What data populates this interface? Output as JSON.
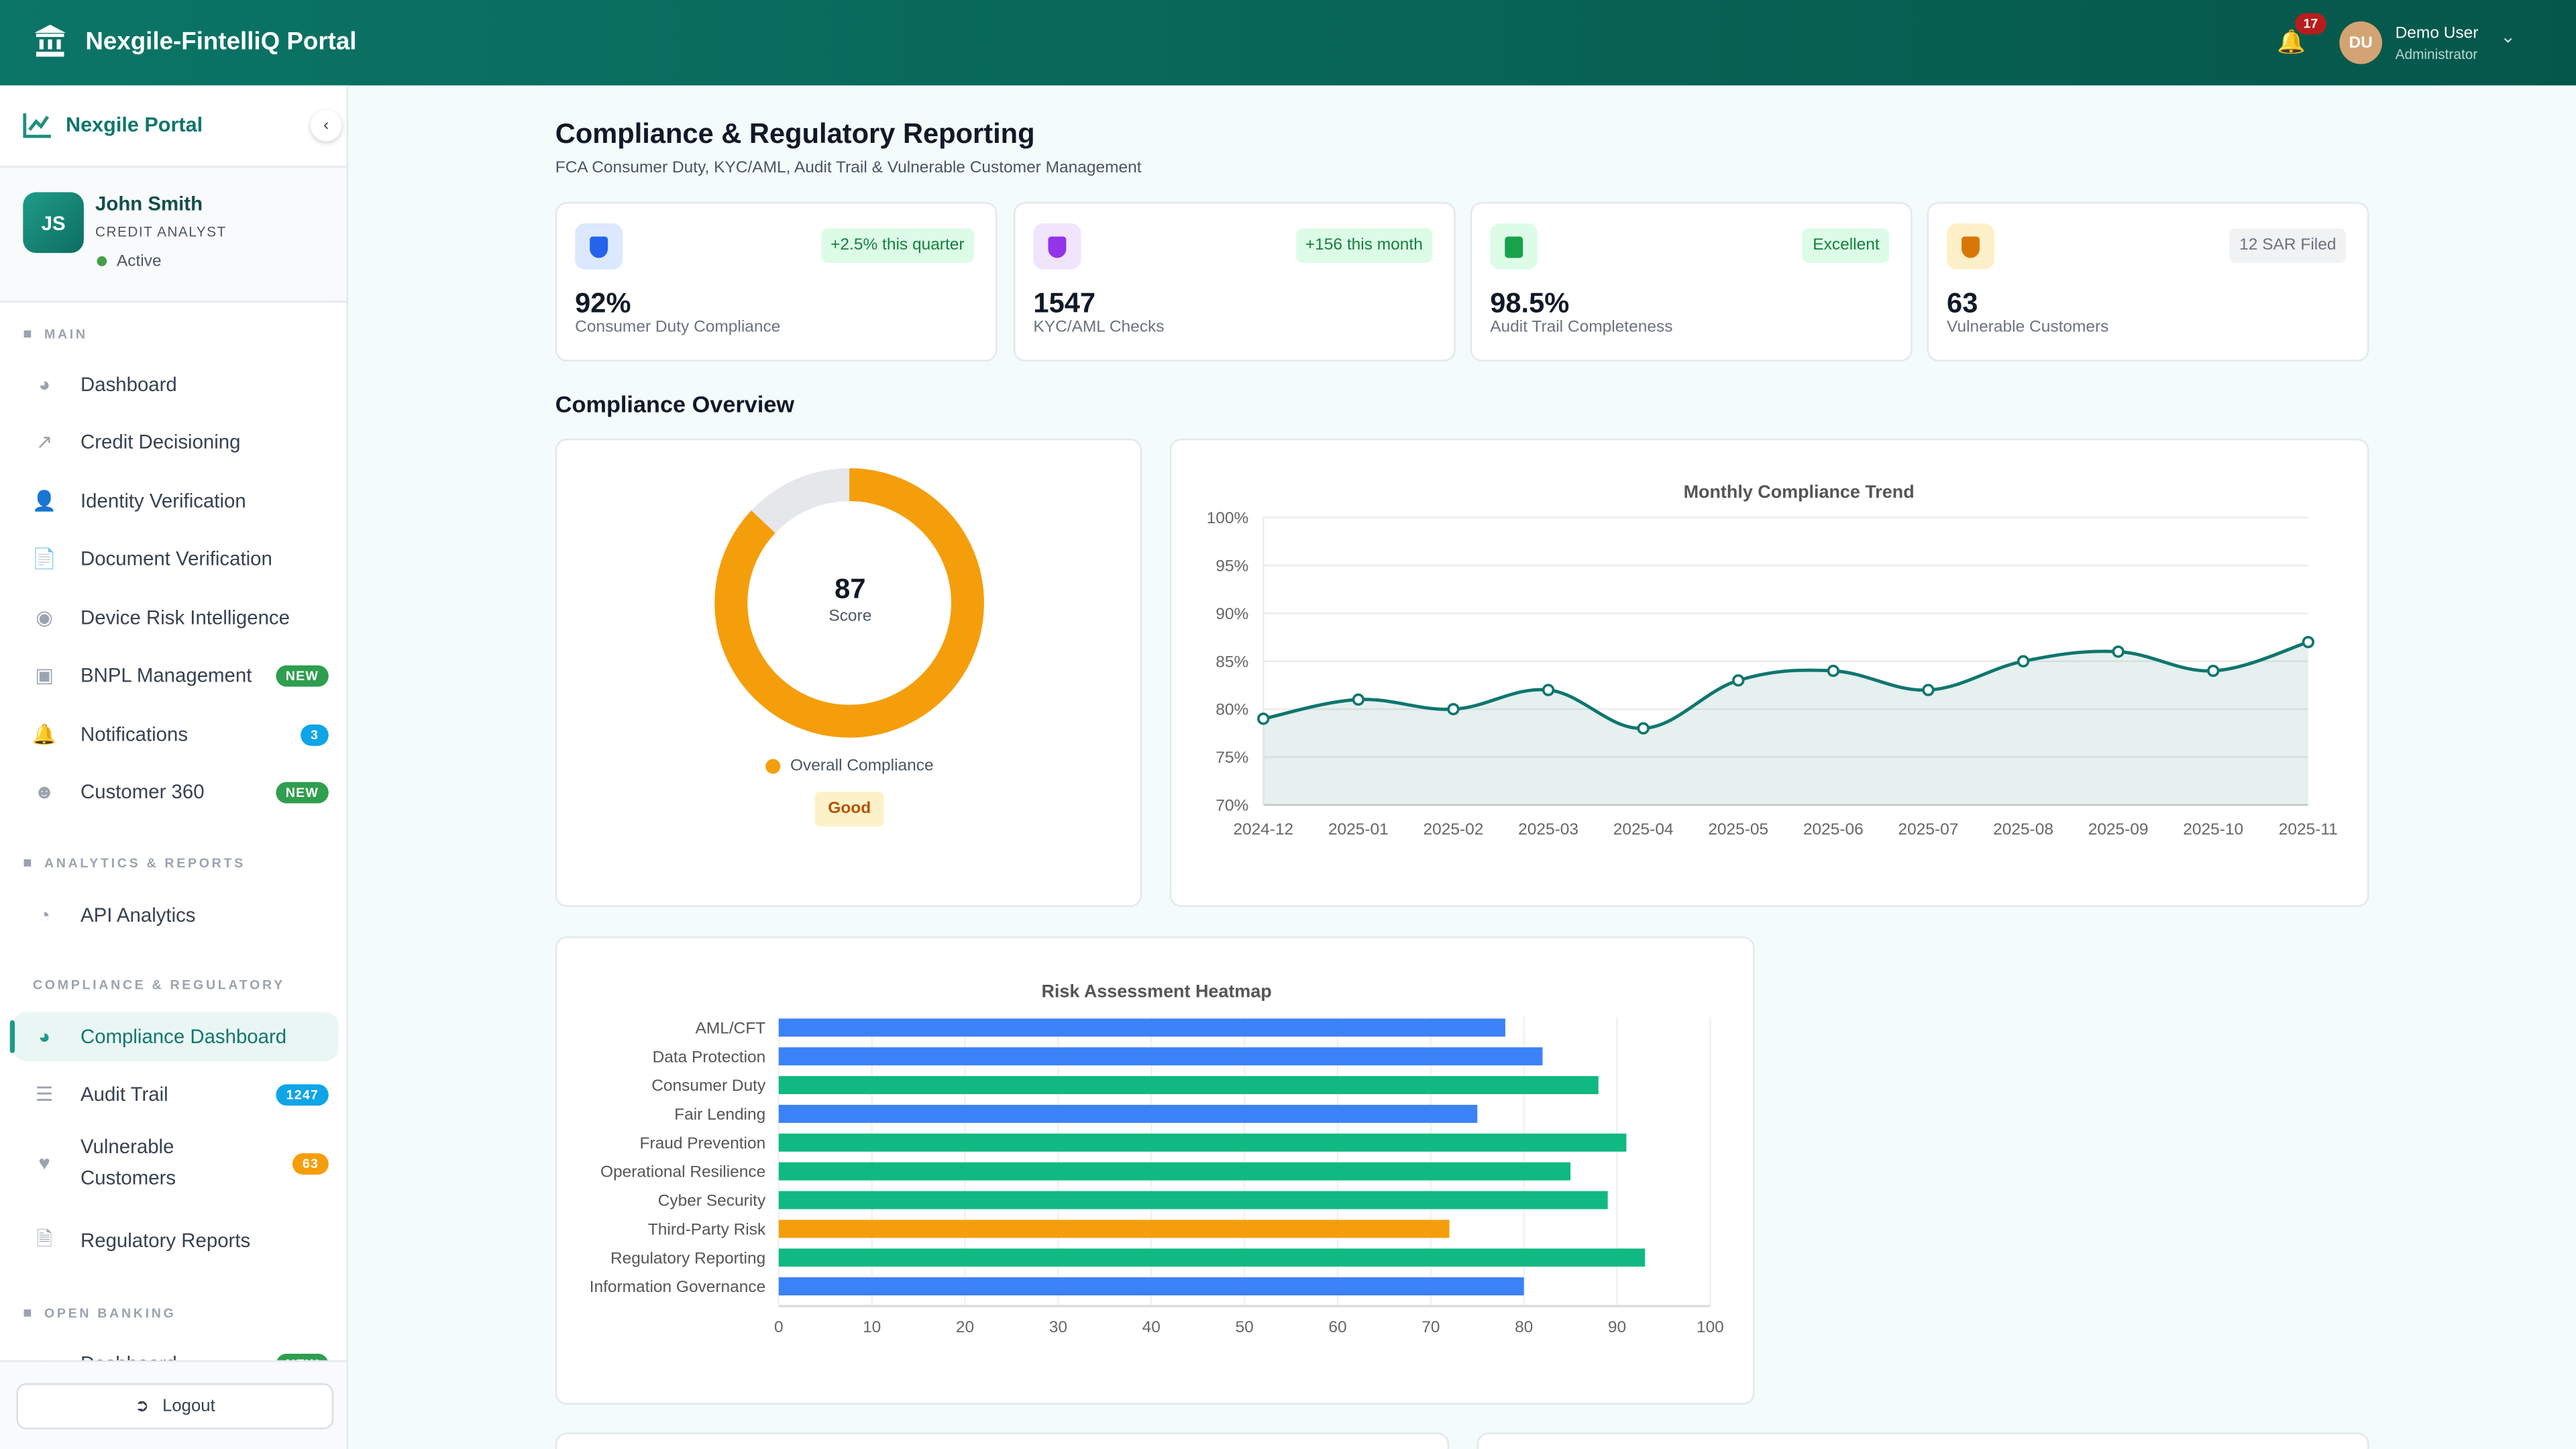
{
  "header": {
    "app_title": "Nexgile-FintelliQ Portal",
    "notification_count": "17",
    "user_initials": "DU",
    "user_name": "Demo User",
    "user_role": "Administrator"
  },
  "sidebar": {
    "brand": "Nexgile Portal",
    "profile": {
      "initials": "JS",
      "name": "John Smith",
      "role": "CREDIT ANALYST",
      "status": "Active"
    },
    "sections": [
      {
        "title": "MAIN",
        "items": [
          {
            "label": "Dashboard",
            "icon": "gauge-icon"
          },
          {
            "label": "Credit Decisioning",
            "icon": "chart-line-icon"
          },
          {
            "label": "Identity Verification",
            "icon": "user-lock-icon"
          },
          {
            "label": "Document Verification",
            "icon": "file-icon"
          },
          {
            "label": "Device Risk Intelligence",
            "icon": "fingerprint-icon"
          },
          {
            "label": "BNPL Management",
            "icon": "wallet-icon",
            "badge": "NEW"
          },
          {
            "label": "Notifications",
            "icon": "bell-icon",
            "badge": "3"
          },
          {
            "label": "Customer 360",
            "icon": "user-circle-icon",
            "badge": "NEW"
          }
        ]
      },
      {
        "title": "ANALYTICS & REPORTS",
        "items": [
          {
            "label": "API Analytics",
            "icon": "pie-chart-icon"
          }
        ]
      },
      {
        "title": "COMPLIANCE & REGULATORY",
        "items": [
          {
            "label": "Compliance Dashboard",
            "icon": "gauge-icon",
            "active": true
          },
          {
            "label": "Audit Trail",
            "icon": "list-check-icon",
            "badge": "1247"
          },
          {
            "label": "Vulnerable Customers",
            "icon": "heart-icon",
            "badge": "63"
          },
          {
            "label": "Regulatory Reports",
            "icon": "file-signature-icon"
          }
        ]
      },
      {
        "title": "OPEN BANKING",
        "items": [
          {
            "label": "Dashboard",
            "icon": "gauge-icon",
            "badge": "NEW"
          }
        ]
      }
    ],
    "logout": "Logout"
  },
  "page": {
    "title": "Compliance & Regulatory Reporting",
    "subtitle": "FCA Consumer Duty, KYC/AML, Audit Trail & Vulnerable Customer Management",
    "overview_heading": "Compliance Overview"
  },
  "kpis": [
    {
      "value": "92%",
      "label": "Consumer Duty Compliance",
      "tag": "+2.5% this quarter",
      "icon": "shield-check-icon",
      "color": "#2563eb"
    },
    {
      "value": "1547",
      "label": "KYC/AML Checks",
      "tag": "+156 this month",
      "icon": "shield-icon",
      "color": "#9333ea"
    },
    {
      "value": "98.5%",
      "label": "Audit Trail Completeness",
      "tag": "Excellent",
      "icon": "checklist-icon",
      "color": "#16a34a"
    },
    {
      "value": "63",
      "label": "Vulnerable Customers",
      "tag": "12 SAR Filed",
      "icon": "shield-plus-icon",
      "color": "#d97706"
    }
  ],
  "score": {
    "value": "87",
    "label": "Score",
    "legend": "Overall Compliance",
    "rating": "Good",
    "max": 100,
    "color": "#f59e0b"
  },
  "chart_data": [
    {
      "type": "line",
      "title": "Monthly Compliance Trend",
      "x": [
        "2024-12",
        "2025-01",
        "2025-02",
        "2025-03",
        "2025-04",
        "2025-05",
        "2025-06",
        "2025-07",
        "2025-08",
        "2025-09",
        "2025-10",
        "2025-11"
      ],
      "values": [
        79,
        81,
        80,
        82,
        78,
        83,
        84,
        82,
        85,
        86,
        84,
        87
      ],
      "ylim": [
        70,
        100
      ],
      "yticks": [
        "70%",
        "75%",
        "80%",
        "85%",
        "90%",
        "95%",
        "100%"
      ],
      "color": "#0f766e",
      "fill": true,
      "grid": true
    },
    {
      "type": "bar",
      "orientation": "horizontal",
      "title": "Risk Assessment Heatmap",
      "categories": [
        "AML/CFT",
        "Data Protection",
        "Consumer Duty",
        "Fair Lending",
        "Fraud Prevention",
        "Operational Resilience",
        "Cyber Security",
        "Third-Party Risk",
        "Regulatory Reporting",
        "Information Governance"
      ],
      "values": [
        78,
        82,
        88,
        75,
        91,
        85,
        89,
        72,
        93,
        80
      ],
      "colors": [
        "#3b82f6",
        "#3b82f6",
        "#10b981",
        "#3b82f6",
        "#10b981",
        "#10b981",
        "#10b981",
        "#f59e0b",
        "#10b981",
        "#3b82f6"
      ],
      "xlim": [
        0,
        100
      ],
      "xticks": [
        "0",
        "10",
        "20",
        "30",
        "40",
        "50",
        "60",
        "70",
        "80",
        "90",
        "100"
      ],
      "grid": true
    }
  ]
}
